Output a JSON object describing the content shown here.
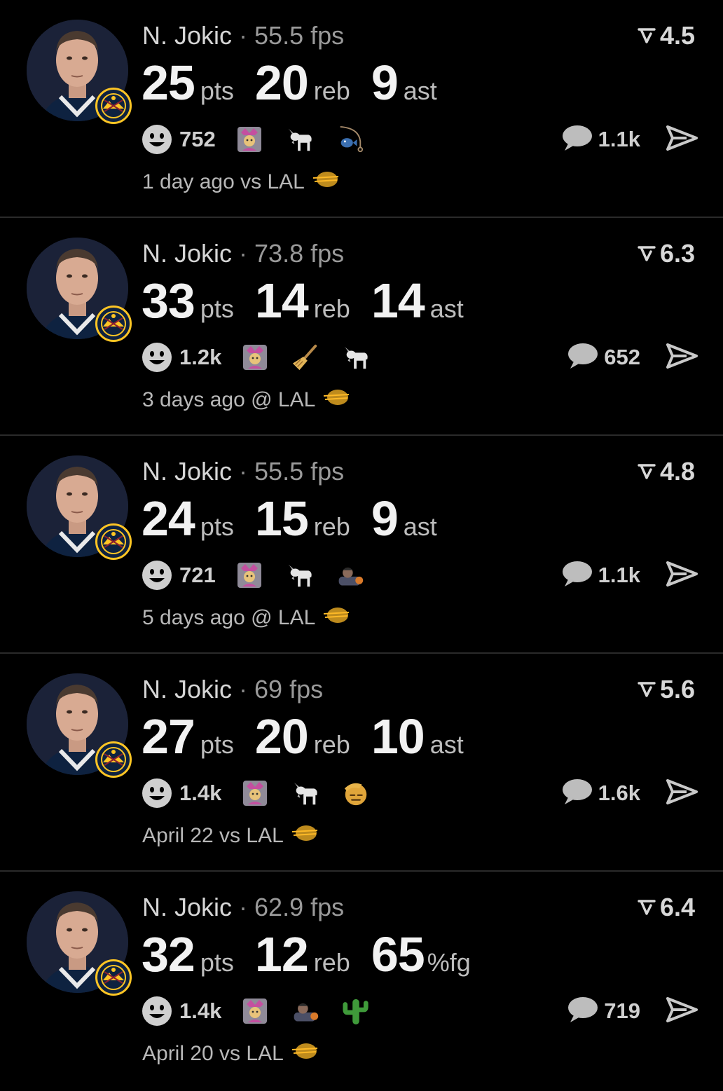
{
  "feed": {
    "posts": [
      {
        "player": "N. Jokic",
        "fps": "55.5 fps",
        "rating": "4.5",
        "stats": [
          {
            "value": "25",
            "unit": "pts"
          },
          {
            "value": "20",
            "unit": "reb"
          },
          {
            "value": "9",
            "unit": "ast"
          }
        ],
        "reaction_count": "752",
        "reactions": [
          "jester-emoji",
          "goat-emoji",
          "fishing-emoji"
        ],
        "comment_count": "1.1k",
        "time": "1 day ago vs LAL"
      },
      {
        "player": "N. Jokic",
        "fps": "73.8 fps",
        "rating": "6.3",
        "stats": [
          {
            "value": "33",
            "unit": "pts"
          },
          {
            "value": "14",
            "unit": "reb"
          },
          {
            "value": "14",
            "unit": "ast"
          }
        ],
        "reaction_count": "1.2k",
        "reactions": [
          "jester-emoji",
          "broom-emoji",
          "goat-emoji"
        ],
        "comment_count": "652",
        "time": "3 days ago @ LAL"
      },
      {
        "player": "N. Jokic",
        "fps": "55.5 fps",
        "rating": "4.8",
        "stats": [
          {
            "value": "24",
            "unit": "pts"
          },
          {
            "value": "15",
            "unit": "reb"
          },
          {
            "value": "9",
            "unit": "ast"
          }
        ],
        "reaction_count": "721",
        "reactions": [
          "jester-emoji",
          "goat-emoji",
          "player-sticker"
        ],
        "comment_count": "1.1k",
        "time": "5 days ago @ LAL"
      },
      {
        "player": "N. Jokic",
        "fps": "69 fps",
        "rating": "5.6",
        "stats": [
          {
            "value": "27",
            "unit": "pts"
          },
          {
            "value": "20",
            "unit": "reb"
          },
          {
            "value": "10",
            "unit": "ast"
          }
        ],
        "reaction_count": "1.4k",
        "reactions": [
          "jester-emoji",
          "goat-emoji",
          "salute-emoji"
        ],
        "comment_count": "1.6k",
        "time": "April 22 vs LAL"
      },
      {
        "player": "N. Jokic",
        "fps": "62.9 fps",
        "rating": "6.4",
        "stats": [
          {
            "value": "32",
            "unit": "pts"
          },
          {
            "value": "12",
            "unit": "reb"
          },
          {
            "value": "65",
            "unit": "%fg"
          }
        ],
        "reaction_count": "1.4k",
        "reactions": [
          "jester-emoji",
          "player-sticker",
          "cactus-emoji"
        ],
        "comment_count": "719",
        "time": "April 20 vs LAL"
      }
    ]
  },
  "colors": {
    "background": "#000000",
    "nuggets_navy": "#0e2240",
    "nuggets_gold": "#fec524",
    "lakers_purple": "#552583",
    "lakers_gold": "#fdb927"
  }
}
